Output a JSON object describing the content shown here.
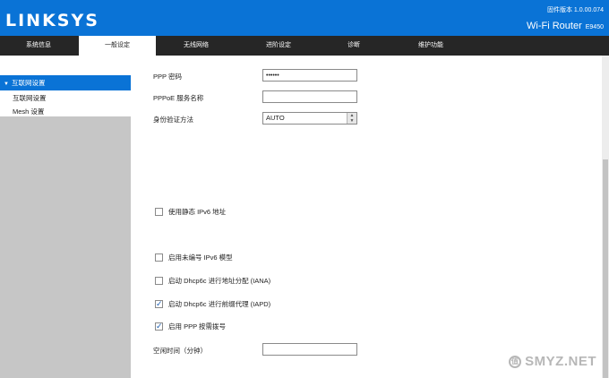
{
  "header": {
    "logo": "LINKSYS",
    "firmware": "固件版本 1.0.00.074",
    "product": "Wi-Fi Router",
    "model": "E9450"
  },
  "nav": {
    "tabs": [
      "系统信息",
      "一般设定",
      "无线网络",
      "进阶设定",
      "诊断",
      "维护功能"
    ],
    "active_tab": "一般设定"
  },
  "sidebar": {
    "section": "互联网设置",
    "items": [
      "互联网设置",
      "Mesh 设置"
    ]
  },
  "form": {
    "ppp_password_label": "PPP 密码",
    "ppp_password_value": "••••••",
    "pppoe_service_label": "PPPoE 服务名称",
    "pppoe_service_value": "",
    "auth_label": "身份验证方法",
    "auth_value": "AUTO",
    "static_ipv6_label": "使用静态 IPv6 地址",
    "static_ipv6_checked": false,
    "unnumbered_ipv6_label": "启用未编号 IPv6 模型",
    "unnumbered_ipv6_checked": false,
    "dhcp6c_iana_label": "启动 Dhcp6c 进行地址分配 (IANA)",
    "dhcp6c_iana_checked": false,
    "dhcp6c_iapd_label": "启动 Dhcp6c 进行前缀代理 (IAPD)",
    "dhcp6c_iapd_checked": true,
    "ppp_on_demand_label": "启用 PPP 按需拨号",
    "ppp_on_demand_checked": true,
    "idle_time_label": "空闲时间（分钟）",
    "idle_time_value": ""
  },
  "watermark": "SMYZ.NET",
  "colors": {
    "brand_blue": "#0a73d6",
    "nav_dark": "#262626",
    "sidebar_gray": "#c6c6c6"
  }
}
